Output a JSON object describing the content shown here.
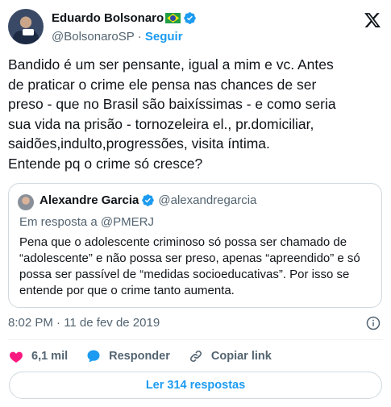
{
  "author": {
    "name": "Eduardo Bolsonaro",
    "handle": "@BolsonaroSP",
    "separator": "·",
    "follow_label": "Seguir"
  },
  "tweet": {
    "text": "Bandido é um ser pensante, igual a mim e vc. Antes\nde praticar o crime ele pensa nas chances de ser\npreso - que no Brasil são baixíssimas - e como seria\nsua vida na prisão - tornozeleira el., pr.domiciliar,\nsaidões,indulto,progressões, visita íntima.\nEntende pq o crime só cresce?"
  },
  "quoted": {
    "name": "Alexandre Garcia",
    "handle": "@alexandregarcia",
    "reply_to": "Em resposta a @PMERJ",
    "text": "Pena que o adolescente criminoso só possa ser chamado de “adolescente” e não possa ser preso, apenas “apreendido” e só possa ser passível de “medidas socioeducativas”. Por isso se entende por que o crime tanto aumenta."
  },
  "meta": {
    "timestamp": "8:02 PM · 11 de fev de 2019"
  },
  "actions": {
    "likes": "6,1 mil",
    "reply_label": "Responder",
    "copy_link_label": "Copiar link"
  },
  "footer": {
    "read_replies_label": "Ler 314 respostas"
  },
  "colors": {
    "accent": "#1d9bf0",
    "like_red": "#f91880",
    "secondary_text": "#536471"
  },
  "icons": [
    "verified-badge-icon",
    "x-logo-icon",
    "info-icon",
    "heart-icon",
    "reply-bubble-icon",
    "link-icon",
    "brazil-flag-icon"
  ]
}
